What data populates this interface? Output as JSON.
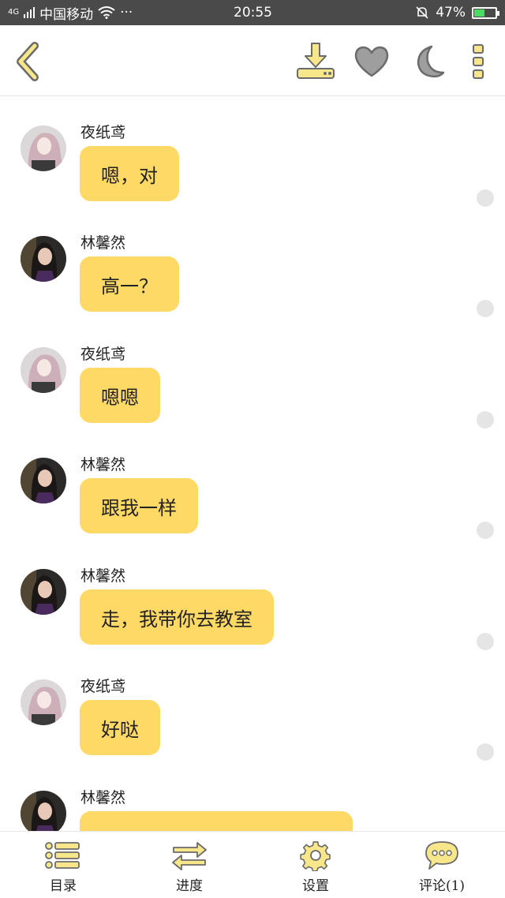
{
  "status_bar": {
    "network": "4G",
    "carrier": "中国移动",
    "dots": "···",
    "time": "20:55",
    "battery": "47%"
  },
  "colors": {
    "bubble": "#ffd966",
    "icon_yellow": "#f7e78a",
    "icon_gray": "#9e9e9e",
    "icon_outline": "#6b6b6b"
  },
  "top_bar": {
    "back_icon": "back-arrow-icon",
    "download_icon": "download-icon",
    "favorite_icon": "heart-icon",
    "night_mode_icon": "moon-icon",
    "more_icon": "more-vertical-icon"
  },
  "messages": [
    {
      "name": "夜纸鸢",
      "text": "嗯，对"
    },
    {
      "name": "林馨然",
      "text": "高一？"
    },
    {
      "name": "夜纸鸢",
      "text": "嗯嗯"
    },
    {
      "name": "林馨然",
      "text": "跟我一样"
    },
    {
      "name": "林馨然",
      "text": "走，我带你去教室"
    },
    {
      "name": "夜纸鸢",
      "text": "好哒"
    },
    {
      "name": "林馨然",
      "text": ""
    }
  ],
  "bottom_bar": {
    "catalog": "目录",
    "progress": "进度",
    "settings": "设置",
    "comments": "评论(1)"
  }
}
